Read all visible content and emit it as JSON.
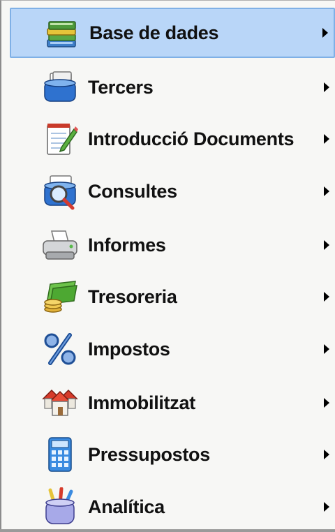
{
  "menu": {
    "items": [
      {
        "label": "Base de dades",
        "icon": "database-books-icon"
      },
      {
        "label": "Tercers",
        "icon": "cardfile-icon"
      },
      {
        "label": "Introducció Documents",
        "icon": "notepad-pencil-icon"
      },
      {
        "label": "Consultes",
        "icon": "search-cards-icon"
      },
      {
        "label": "Informes",
        "icon": "printer-icon"
      },
      {
        "label": "Tresoreria",
        "icon": "money-icon"
      },
      {
        "label": "Impostos",
        "icon": "percent-icon"
      },
      {
        "label": "Immobilitzat",
        "icon": "houses-icon"
      },
      {
        "label": "Pressupostos",
        "icon": "calculator-icon"
      },
      {
        "label": "Analítica",
        "icon": "pencil-cup-icon"
      }
    ],
    "selected_index": 0,
    "colors": {
      "selection_bg": "#b9d6f8",
      "selection_border": "#7fb0e6",
      "menu_bg": "#f7f7f5"
    }
  }
}
